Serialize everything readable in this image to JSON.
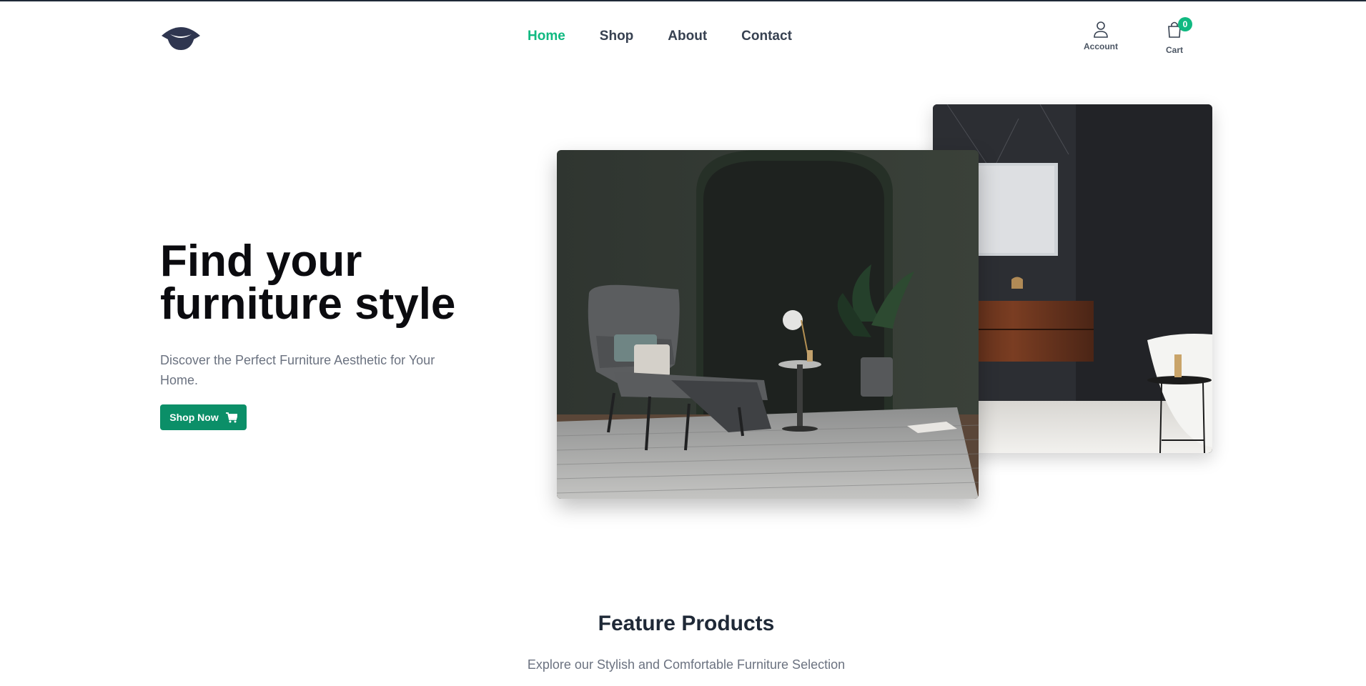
{
  "nav": {
    "items": [
      {
        "label": "Home",
        "active": true
      },
      {
        "label": "Shop",
        "active": false
      },
      {
        "label": "About",
        "active": false
      },
      {
        "label": "Contact",
        "active": false
      }
    ]
  },
  "header": {
    "account_label": "Account",
    "cart_label": "Cart",
    "cart_count": "0",
    "logo_icon": "bowl-logo-icon"
  },
  "hero": {
    "title_line1": "Find your",
    "title_line2": "furniture style",
    "subtitle": "Discover the Perfect Furniture Aesthetic for Your Home.",
    "cta_label": "Shop Now",
    "cta_icon": "cart-icon"
  },
  "featured": {
    "title": "Feature Products",
    "subtitle": "Explore our Stylish and Comfortable Furniture Selection"
  },
  "colors": {
    "accent": "#10b981",
    "cta": "#0b8f68",
    "heading": "#0b0b0f",
    "muted": "#6b7280"
  }
}
